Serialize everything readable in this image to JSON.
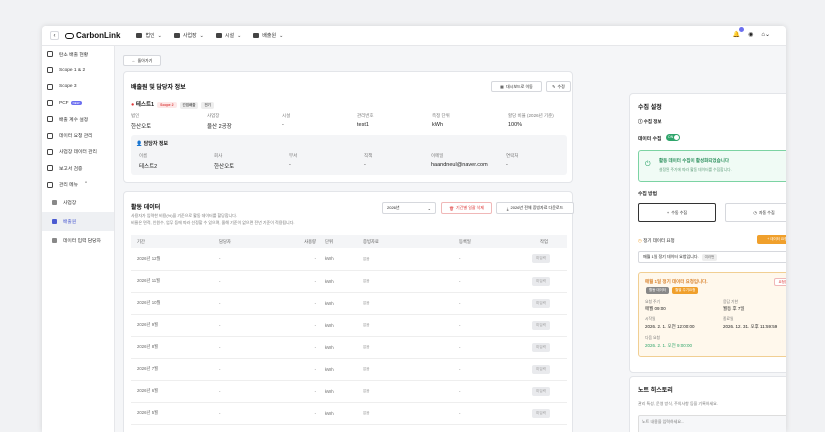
{
  "logo": "CarbonLink",
  "nav": [
    "법인",
    "사업장",
    "시설",
    "배출원"
  ],
  "sidebar": [
    "탄소 배출 현황",
    "Scope 1 & 2",
    "Scope 3",
    "PCF",
    "배출 계수 설정",
    "데이터 요청 관리",
    "사업장 데이터 관리",
    "보고서 검증",
    "관리 메뉴",
    "사업장",
    "배출원",
    "데이터 입력 담당자"
  ],
  "pcf_badge": "NEW",
  "back_label": "돌아가기",
  "info": {
    "title": "배출원 및 담당자 정보",
    "dash_btn": "대시보드로 이동",
    "edit_btn": "수정",
    "name": "테스트1",
    "tag1": "Scope 2",
    "tag2": "간접배출",
    "tag3": "전기",
    "labels": [
      "법인",
      "사업장",
      "시설",
      "관리번호",
      "측정 단위",
      "할당 비율 (2026년 기준)"
    ],
    "values": [
      "한산오토",
      "울산 2공장",
      "-",
      "test1",
      "kWh",
      "100%"
    ],
    "contact_title": "담당자 정보",
    "clabels": [
      "이름",
      "회사",
      "부서",
      "직책",
      "이메일",
      "연락처"
    ],
    "cvalues": [
      "테스트2",
      "한산오토",
      "-",
      "-",
      "haandneul@naver.com",
      "-"
    ]
  },
  "activity": {
    "title": "활동 데이터",
    "desc1": "사용자가 입력한 비용(%)을 기준으로 활동 데이터를 할당합니다.",
    "desc2": "비율은 면적, 인원수, 업무 등에 따라 선정할 수 있으며, 올해 기준이 없으면 전년 기준이 적용됩니다.",
    "year": "2026년",
    "del_btn": "기간별 일괄 삭제",
    "dl_btn": "2026년 전체 증빙자료 다운로드",
    "headers": [
      "기간",
      "담당자",
      "사용량",
      "단위",
      "증빙자료",
      "등록일",
      "작업"
    ],
    "rows": [
      [
        "2026년 12월",
        "-",
        "-",
        "kWh",
        "없음",
        "-",
        "미입력"
      ],
      [
        "2026년 11월",
        "-",
        "-",
        "kWh",
        "없음",
        "-",
        "미입력"
      ],
      [
        "2026년 10월",
        "-",
        "-",
        "kWh",
        "없음",
        "-",
        "미입력"
      ],
      [
        "2026년 9월",
        "-",
        "-",
        "kWh",
        "없음",
        "-",
        "미입력"
      ],
      [
        "2026년 8월",
        "-",
        "-",
        "kWh",
        "없음",
        "-",
        "미입력"
      ],
      [
        "2026년 7월",
        "-",
        "-",
        "kWh",
        "없음",
        "-",
        "미입력"
      ],
      [
        "2026년 6월",
        "-",
        "-",
        "kWh",
        "없음",
        "-",
        "미입력"
      ],
      [
        "2026년 5월",
        "-",
        "-",
        "kWh",
        "없음",
        "-",
        "미입력"
      ]
    ]
  },
  "collect": {
    "title": "수집 설정",
    "info": "수집 정보",
    "toggle_label": "데이터 수집",
    "toggle": "ON",
    "alert_title": "활동 데이터 수집이 활성화되었습니다",
    "alert_sub": "설정된 주기에 따라 활동 데이터를 수집합니다.",
    "method": "수집 방법",
    "manual": "수동 수집",
    "auto": "자동 수집",
    "periodic": "정기 데이터 요청",
    "add_btn": "+ 데이터 요청 생성",
    "select": "매월 1일 정기 데이터 요청입니다.",
    "select_tag": "여러번",
    "req_title": "매월 1일 정기 데이터 요청입니다.",
    "req_tag1": "활동 데이터",
    "req_tag2": "월별 주기요청",
    "req_delete": "요청을 해지",
    "f1l": "요청 주기",
    "f1v": "매월 09:00",
    "f2l": "응답 기한",
    "f2v": "월등 후 7일",
    "f3l": "시작일",
    "f3v": "2026. 2. 1. 오전 12:00:00",
    "f4l": "종료일",
    "f4v": "2026. 12. 31. 오후 11:59:59",
    "f5l": "다음 요청",
    "f5v": "2026. 2. 1. 오전 9:00:00"
  },
  "note": {
    "title": "노트 히스토리",
    "desc": "관리 특성, 운영 방식, 주의사항 등을 기록하세요.",
    "placeholder": "노트 내용을 입력하세요..."
  },
  "colors": {
    "accent": "#4b5bd1",
    "green": "#2fa56b",
    "orange": "#f0a02c"
  }
}
